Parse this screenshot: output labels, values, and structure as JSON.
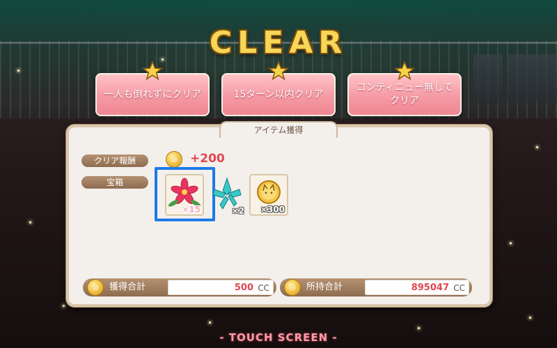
{
  "header": {
    "title": "CLEAR"
  },
  "missions": [
    {
      "label": "一人も倒れずにクリア",
      "icon": "star-icon"
    },
    {
      "label": "15ターン以内クリア",
      "icon": "star-icon"
    },
    {
      "label": "コンティニュー無しでクリア",
      "line1": "コンティニュー無しで",
      "line2": "クリア",
      "icon": "star-icon"
    }
  ],
  "panel": {
    "tab_label": "アイテム獲得",
    "clear_reward": {
      "label": "クリア報酬",
      "value": "+200",
      "icon": "coin-icon"
    },
    "treasure": {
      "label": "宝箱",
      "items": [
        {
          "name": "flower-bouquet",
          "qty": "×15",
          "selected": true,
          "icon": "flower-icon"
        },
        {
          "name": "crystal",
          "qty": "×2",
          "selected": false,
          "icon": "crystal-icon"
        },
        {
          "name": "coin",
          "qty": "×300",
          "selected": false,
          "icon": "coin-icon"
        }
      ]
    },
    "totals": {
      "acquired": {
        "label": "獲得合計",
        "value": "500",
        "unit": "CC"
      },
      "owned": {
        "label": "所持合計",
        "value": "895047",
        "unit": "CC"
      }
    }
  },
  "footer": {
    "touch_label": "- TOUCH SCREEN -"
  },
  "colors": {
    "accent_gold": "#f7d658",
    "mission_pink": "#f59aa4",
    "value_red": "#e0464f",
    "select_blue": "#1e7ae6"
  }
}
